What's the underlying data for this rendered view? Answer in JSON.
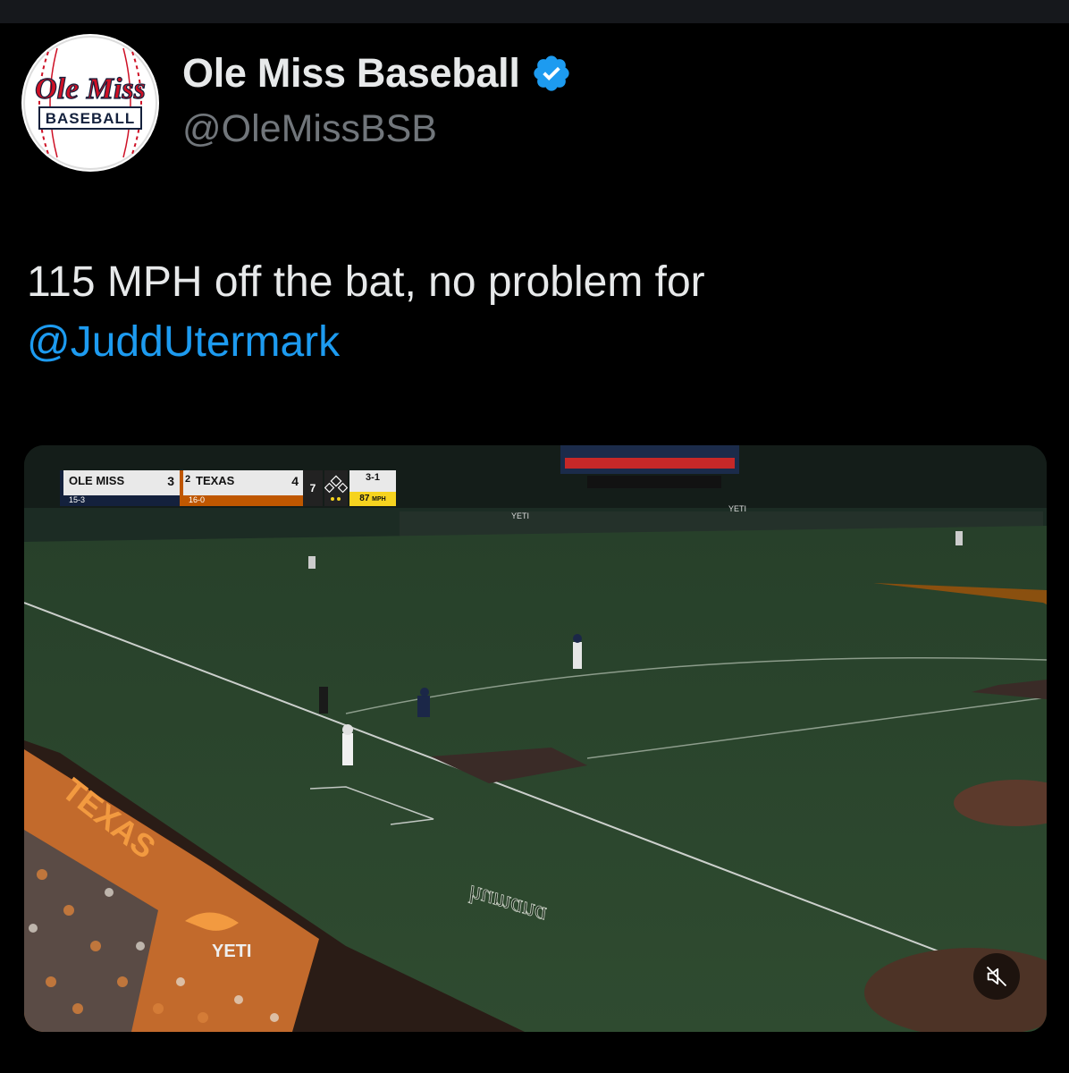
{
  "author": {
    "display_name": "Ole Miss Baseball",
    "handle": "@OleMissBSB",
    "verified": true,
    "avatar_logo_text": "Ole Miss",
    "avatar_sub_text": "BASEBALL"
  },
  "tweet": {
    "text": "115 MPH off the bat, no problem for",
    "mention": "@JuddUtermark"
  },
  "video": {
    "scorebug": {
      "away_team": "OLE MISS",
      "away_record": "15-3",
      "away_score": "3",
      "home_rank": "2",
      "home_team": "TEXAS",
      "home_record": "16-0",
      "home_score": "4",
      "inning": "7",
      "count": "3-1",
      "pitch_speed": "87",
      "pitch_unit": "MPH"
    },
    "field_text": {
      "foul_line_sponsor": "humana",
      "wall_sponsor": "YETI",
      "dugout_sponsor": "YETI"
    },
    "mute_icon": "speaker-muted-icon"
  },
  "colors": {
    "verified_blue": "#1d9bf0",
    "link_blue": "#1d9bf0",
    "ole_miss_red": "#ce1126",
    "ole_miss_navy": "#14213d",
    "texas_orange": "#bf5700"
  }
}
